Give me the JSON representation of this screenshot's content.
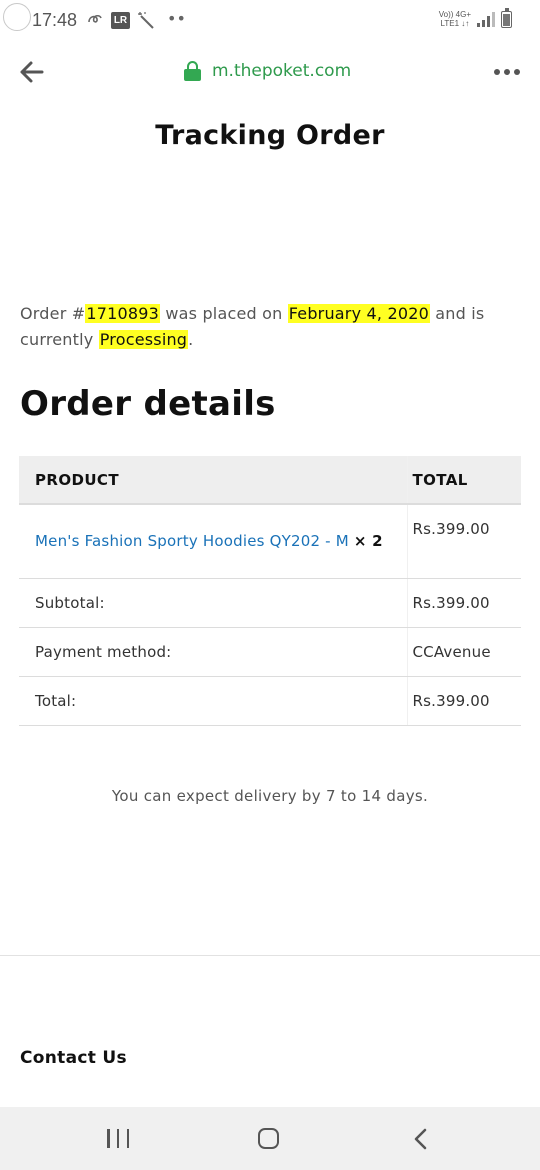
{
  "status_bar": {
    "time": "17:48",
    "lr_badge": "LR",
    "dots": "••",
    "network_top": "Vo)) 4G+",
    "network_bottom": "LTE1 ↓↑"
  },
  "browser": {
    "url": "m.thepoket.com",
    "icons": [
      "back-arrow-icon",
      "lock-icon",
      "more-options-icon"
    ]
  },
  "page": {
    "title": "Tracking Order",
    "summary": {
      "prefix": "Order #",
      "order_number": "1710893",
      "placed_text": " was placed on ",
      "date": "February 4, 2020",
      "middle_text": " and is currently ",
      "status": "Processing",
      "suffix": "."
    },
    "details_heading": "Order details",
    "table": {
      "headers": {
        "product": "PRODUCT",
        "total": "TOTAL"
      },
      "product": {
        "name": "Men's Fashion Sporty Hoodies QY202 - M",
        "quantity": "× 2",
        "total": "Rs.399.00"
      },
      "rows": [
        {
          "label": "Subtotal:",
          "value": "Rs.399.00"
        },
        {
          "label": "Payment method:",
          "value": "CCAvenue"
        },
        {
          "label": "Total:",
          "value": "Rs.399.00"
        }
      ]
    },
    "delivery_note": "You can expect delivery by 7 to 14 days.",
    "contact_heading": "Contact Us"
  },
  "colors": {
    "highlight": "#ffff22",
    "link": "#1a72b8",
    "secure": "#33a852"
  },
  "battery_level": 0.75
}
